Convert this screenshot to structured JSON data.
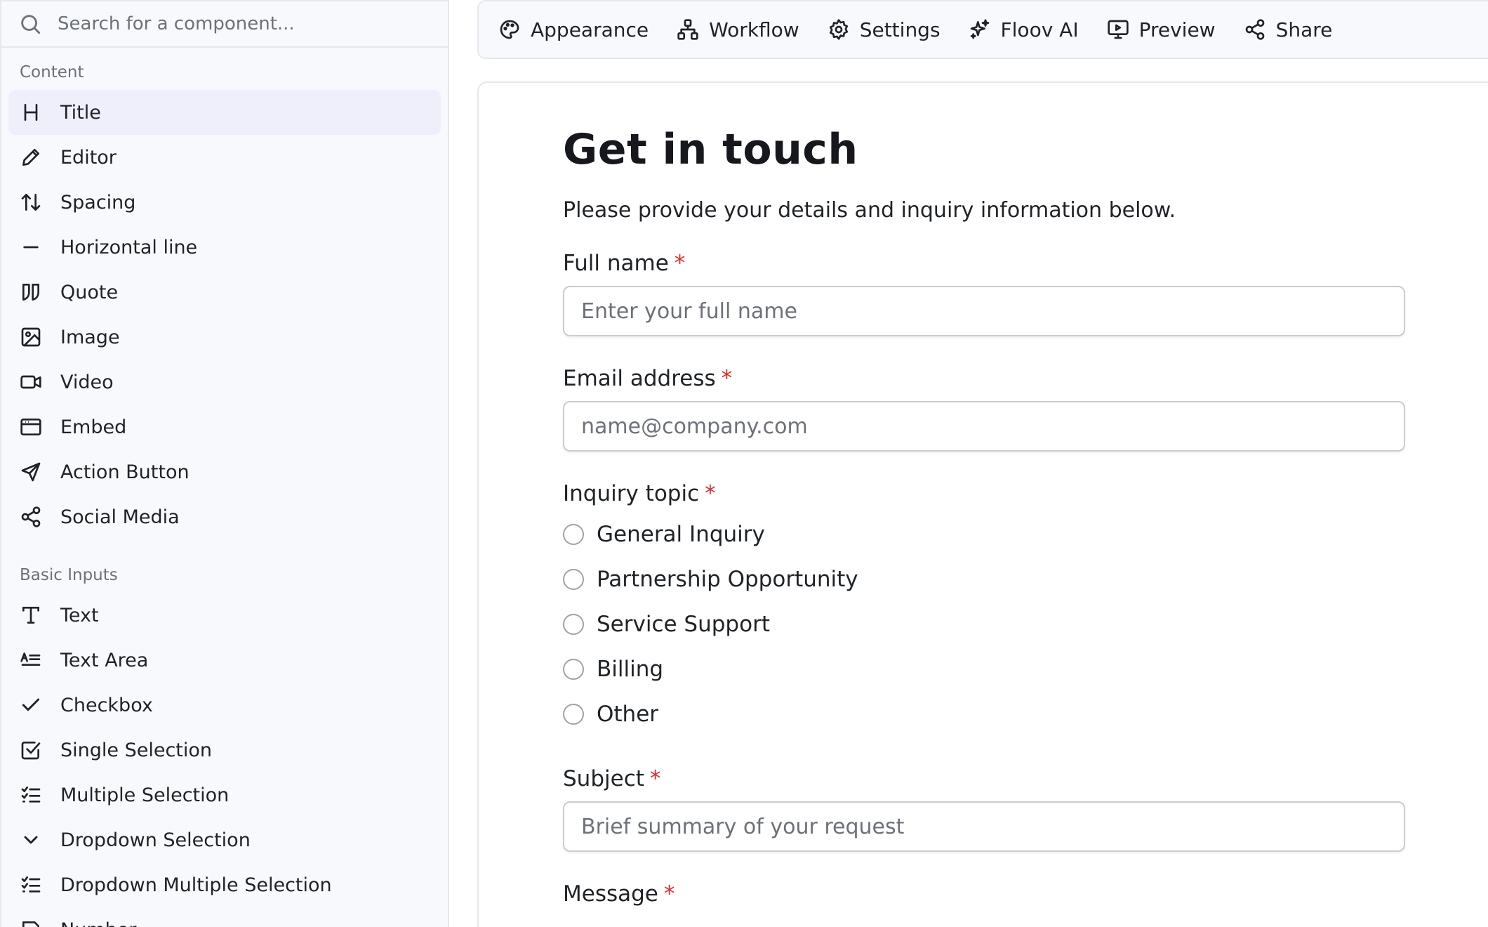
{
  "search": {
    "placeholder": "Search for a component..."
  },
  "sidebar": {
    "groups": [
      {
        "title": "Content",
        "items": [
          {
            "label": "Title",
            "icon": "heading-icon"
          },
          {
            "label": "Editor",
            "icon": "pencil-icon"
          },
          {
            "label": "Spacing",
            "icon": "arrows-up-down-icon"
          },
          {
            "label": "Horizontal line",
            "icon": "minus-icon"
          },
          {
            "label": "Quote",
            "icon": "quote-icon"
          },
          {
            "label": "Image",
            "icon": "image-icon"
          },
          {
            "label": "Video",
            "icon": "video-icon"
          },
          {
            "label": "Embed",
            "icon": "browser-window-icon"
          },
          {
            "label": "Action Button",
            "icon": "send-icon"
          },
          {
            "label": "Social Media",
            "icon": "share-icon"
          }
        ]
      },
      {
        "title": "Basic Inputs",
        "items": [
          {
            "label": "Text",
            "icon": "type-icon"
          },
          {
            "label": "Text Area",
            "icon": "text-area-icon"
          },
          {
            "label": "Checkbox",
            "icon": "check-icon"
          },
          {
            "label": "Single Selection",
            "icon": "square-check-icon"
          },
          {
            "label": "Multiple Selection",
            "icon": "list-checks-icon"
          },
          {
            "label": "Dropdown Selection",
            "icon": "chevron-down-icon"
          },
          {
            "label": "Dropdown Multiple Selection",
            "icon": "list-checks-icon"
          },
          {
            "label": "Number",
            "icon": "number-icon"
          }
        ]
      }
    ]
  },
  "toolbar": {
    "items": [
      {
        "label": "Appearance",
        "icon": "palette-icon"
      },
      {
        "label": "Workflow",
        "icon": "workflow-icon"
      },
      {
        "label": "Settings",
        "icon": "gear-icon"
      },
      {
        "label": "Floov AI",
        "icon": "sparkles-icon"
      },
      {
        "label": "Preview",
        "icon": "monitor-play-icon"
      },
      {
        "label": "Share",
        "icon": "share-icon"
      }
    ]
  },
  "form": {
    "title": "Get in touch",
    "description": "Please provide your details and inquiry information below.",
    "required_mark": "*",
    "full_name": {
      "label": "Full name",
      "placeholder": "Enter your full name"
    },
    "email": {
      "label": "Email address",
      "placeholder": "name@company.com"
    },
    "inquiry": {
      "label": "Inquiry topic",
      "options": [
        "General Inquiry",
        "Partnership Opportunity",
        "Service Support",
        "Billing",
        "Other"
      ]
    },
    "subject": {
      "label": "Subject",
      "placeholder": "Brief summary of your request"
    },
    "message": {
      "label": "Message"
    }
  },
  "colors": {
    "active_item_bg": "#efeffb",
    "required": "#d92d2d",
    "sidebar_bg": "#f8f9fc"
  }
}
